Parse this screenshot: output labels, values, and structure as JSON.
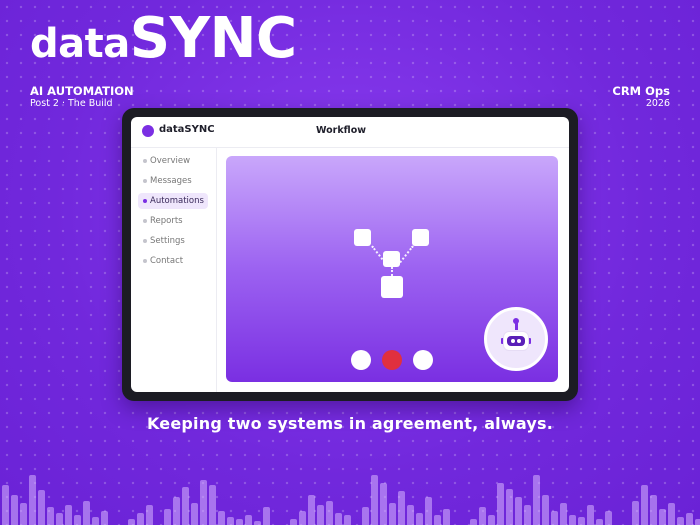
{
  "brand": {
    "title_lower": "data",
    "title_upper": "SYNC"
  },
  "tag_left": {
    "main": "AI AUTOMATION",
    "sub": "Post 2 · The Build"
  },
  "tag_right": {
    "main": "CRM Ops",
    "sub": "2026"
  },
  "app": {
    "name": "dataSYNC",
    "page_title": "Workflow",
    "nav": [
      {
        "label": "Overview",
        "active": false
      },
      {
        "label": "Messages",
        "active": false
      },
      {
        "label": "Automations",
        "active": true
      },
      {
        "label": "Reports",
        "active": false
      },
      {
        "label": "Settings",
        "active": false
      },
      {
        "label": "Contact",
        "active": false
      }
    ],
    "workflow_steps": {
      "count": 3,
      "active_index": 1
    },
    "colors": {
      "accent": "#7b2fe3",
      "active_step": "#e0303f"
    },
    "icons": {
      "logo": "logo-dot-icon",
      "assistant": "robot-icon",
      "workflow": "workflow-nodes-icon"
    }
  },
  "tagline": "Keeping two systems in agreement, always."
}
